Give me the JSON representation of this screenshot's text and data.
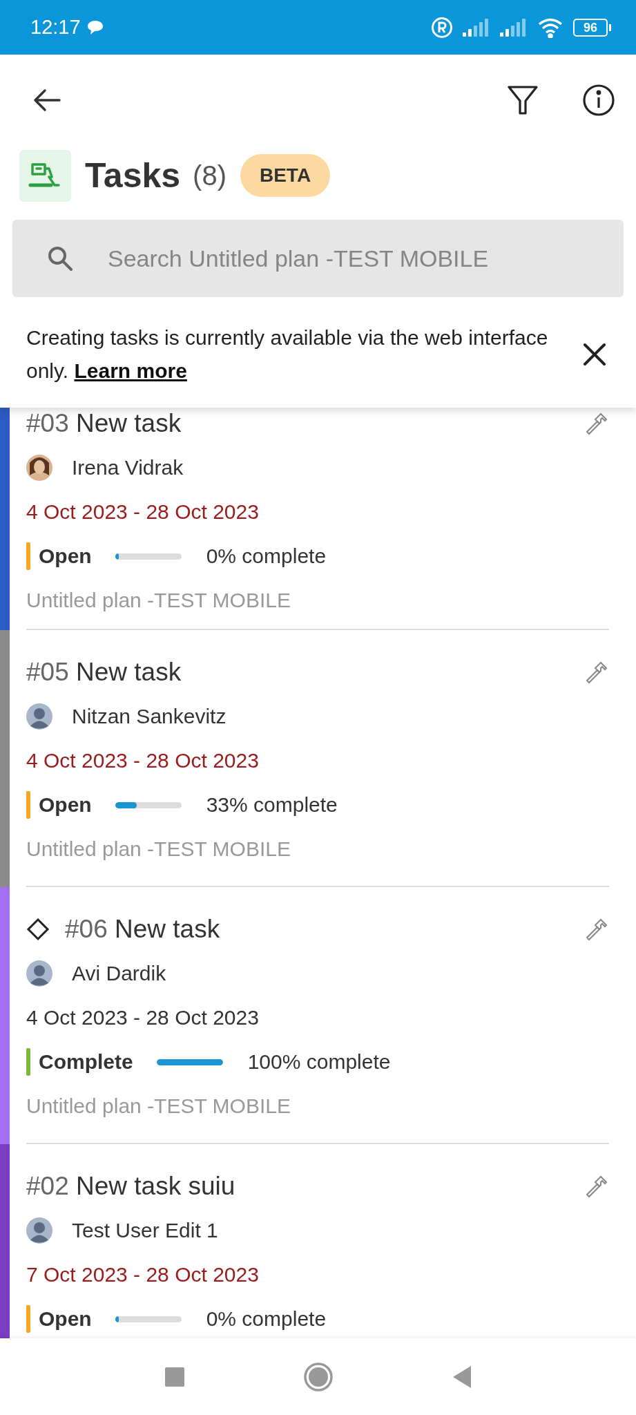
{
  "status_bar": {
    "time": "12:17",
    "battery": "96"
  },
  "header": {
    "title": "Tasks",
    "count": "(8)",
    "badge": "BETA"
  },
  "search": {
    "placeholder": "Search Untitled plan -TEST MOBILE"
  },
  "banner": {
    "text": "Creating tasks is currently available via the web interface only.",
    "link": "Learn more"
  },
  "tasks": [
    {
      "number": "#03",
      "title": "New task",
      "milestone": false,
      "color": "#2d5bc4",
      "assignee": "Irena Vidrak",
      "dates": "4 Oct 2023 - 28 Oct 2023",
      "overdue": true,
      "status": {
        "label": "Open",
        "color": "#f5a623"
      },
      "level": 0,
      "progress": "0% complete",
      "plan": "Untitled plan -TEST MOBILE"
    },
    {
      "number": "#05",
      "title": "New task",
      "milestone": false,
      "color": "#8a8a8a",
      "assignee": "Nitzan Sankevitz",
      "avatar": {
        "kind": "silhouette"
      },
      "dates": "4 Oct 2023 - 28 Oct 2023",
      "overdue": true,
      "status": {
        "label": "Open",
        "color": "#f5a623"
      },
      "level": 0.33,
      "progress": "33% complete",
      "plan": "Untitled plan -TEST MOBILE"
    },
    {
      "number": "#06",
      "title": "New task",
      "milestone": true,
      "color": "#a66ff0",
      "assignee": "Avi Dardik",
      "avatar": {
        "kind": "silhouette"
      },
      "dates": "4 Oct 2023 - 28 Oct 2023",
      "overdue": false,
      "status": {
        "label": "Complete",
        "color": "#7bb83b"
      },
      "level": 1,
      "progress": "100% complete",
      "plan": "Untitled plan -TEST MOBILE"
    },
    {
      "number": "#02",
      "title": "New task suiu",
      "milestone": false,
      "color": "#7a3cc0",
      "assignee": "Test User Edit 1",
      "avatar": {
        "kind": "silhouette"
      },
      "dates": "7 Oct 2023 - 28 Oct 2023",
      "overdue": true,
      "status": {
        "label": "Open",
        "color": "#f5a623"
      },
      "level": 0,
      "progress": "0% complete"
    }
  ]
}
